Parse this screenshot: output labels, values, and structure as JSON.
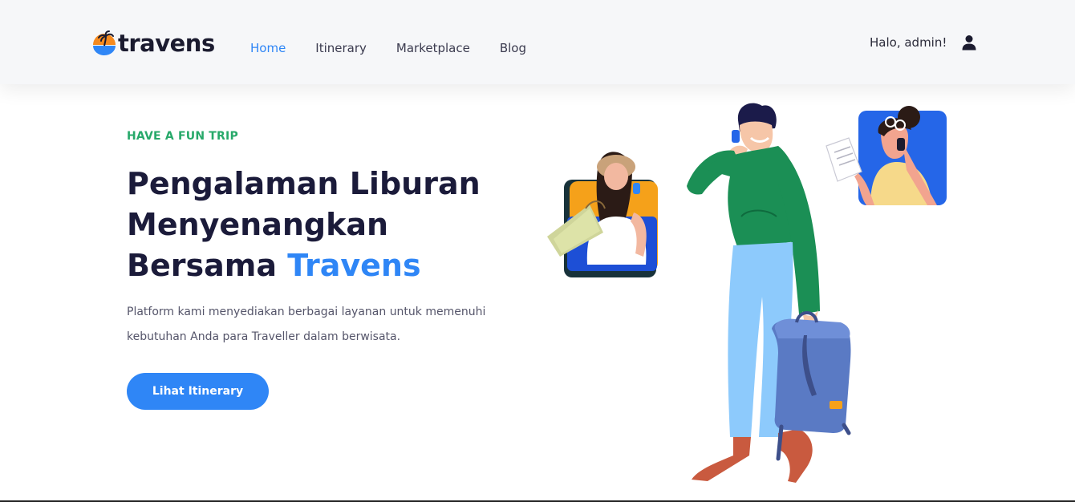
{
  "brand": {
    "name": "travens"
  },
  "nav": {
    "items": [
      {
        "label": "Home",
        "active": true
      },
      {
        "label": "Itinerary",
        "active": false
      },
      {
        "label": "Marketplace",
        "active": false
      },
      {
        "label": "Blog",
        "active": false
      }
    ]
  },
  "user": {
    "greeting": "Halo, admin!",
    "icon": "user-icon"
  },
  "hero": {
    "eyebrow": "HAVE A FUN TRIP",
    "title_line1": "Pengalaman Liburan",
    "title_line2": "Menyenangkan",
    "title_line3_prefix": "Bersama ",
    "title_line3_accent": "Travens",
    "description": "Platform kami menyediakan berbagai layanan untuk memenuhi kebutuhan Anda para Traveller dalam berwisata.",
    "cta_label": "Lihat Itinerary"
  },
  "colors": {
    "accent": "#2f86f6",
    "eyebrow": "#27a96a",
    "heading": "#1b1b3a",
    "navbar_bg": "#f6f7f9"
  }
}
